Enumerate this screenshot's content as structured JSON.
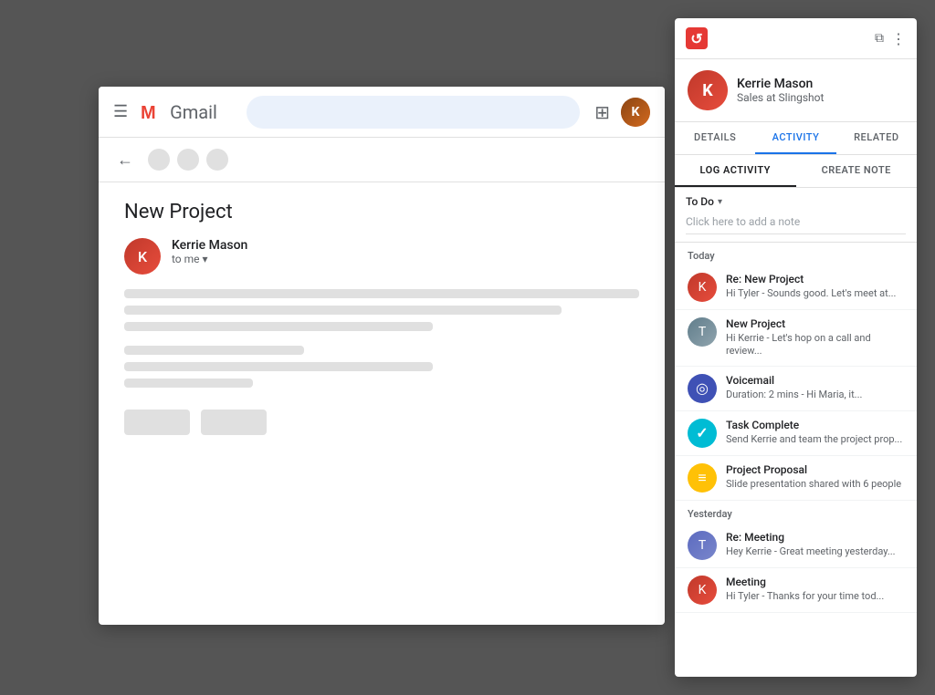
{
  "gmail": {
    "logo_text": "Gmail",
    "search_placeholder": "",
    "email_subject": "New Project",
    "sender_name": "Kerrie Mason",
    "sender_to": "to me",
    "nav_back": "←"
  },
  "crm": {
    "logo_char": "c",
    "profile": {
      "name": "Kerrie Mason",
      "subtitle": "Sales at Slingshot"
    },
    "tabs": [
      {
        "label": "DETAILS",
        "active": false
      },
      {
        "label": "ACTIVITY",
        "active": true
      },
      {
        "label": "RELATED",
        "active": false
      }
    ],
    "subtabs": [
      {
        "label": "LOG ACTIVITY",
        "active": true
      },
      {
        "label": "CREATE NOTE",
        "active": false
      }
    ],
    "todo_label": "To Do",
    "note_placeholder": "Click here to add a note",
    "sections": [
      {
        "header": "Today",
        "items": [
          {
            "title": "Re: New Project",
            "preview": "Hi Tyler - Sounds good. Let's meet at...",
            "icon_type": "person-red",
            "icon_char": "K"
          },
          {
            "title": "New Project",
            "preview": "Hi Kerrie - Let's hop on a call and review...",
            "icon_type": "person-gray",
            "icon_char": "T"
          },
          {
            "title": "Voicemail",
            "preview": "Duration: 2 mins - Hi Maria, it...",
            "icon_type": "voicemail",
            "icon_char": "◎"
          },
          {
            "title": "Task Complete",
            "preview": "Send Kerrie and team the project prop...",
            "icon_type": "task-complete",
            "icon_char": "✓"
          },
          {
            "title": "Project Proposal",
            "preview": "Slide presentation shared with 6 people",
            "icon_type": "document",
            "icon_char": "≡"
          }
        ]
      },
      {
        "header": "Yesterday",
        "items": [
          {
            "title": "Re: Meeting",
            "preview": "Hey Kerrie - Great meeting yesterday...",
            "icon_type": "person-blue",
            "icon_char": "T"
          },
          {
            "title": "Meeting",
            "preview": "Hi Tyler - Thanks for your time tod...",
            "icon_type": "person-red",
            "icon_char": "K"
          }
        ]
      }
    ]
  }
}
